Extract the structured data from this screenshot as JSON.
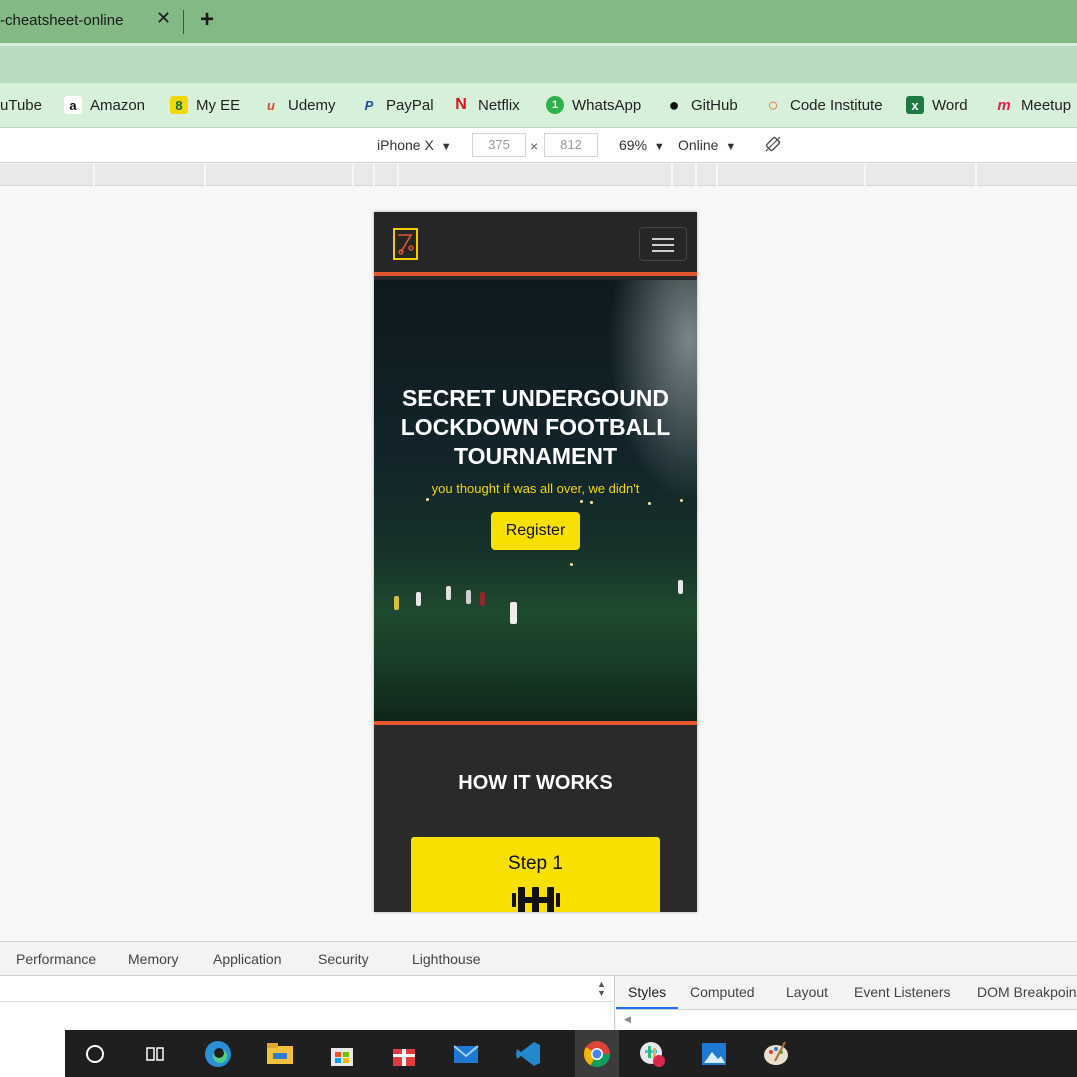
{
  "browser": {
    "tab_title": "-cheatsheet-online",
    "tab_close": "✕",
    "new_tab": "+"
  },
  "bookmarks": [
    {
      "label": "uTube",
      "icon": "youtube-icon"
    },
    {
      "label": "Amazon",
      "icon": "amazon-icon",
      "glyph": "a"
    },
    {
      "label": "My EE",
      "icon": "ee-icon",
      "glyph": "8"
    },
    {
      "label": "Udemy",
      "icon": "udemy-icon",
      "glyph": "u"
    },
    {
      "label": "PayPal",
      "icon": "paypal-icon",
      "glyph": "P"
    },
    {
      "label": "Netflix",
      "icon": "netflix-icon",
      "glyph": "N"
    },
    {
      "label": "WhatsApp",
      "icon": "whatsapp-icon",
      "glyph": "1"
    },
    {
      "label": "GitHub",
      "icon": "github-icon",
      "glyph": "●"
    },
    {
      "label": "Code Institute",
      "icon": "code-institute-icon",
      "glyph": "○"
    },
    {
      "label": "Word",
      "icon": "excel-icon",
      "glyph": "x"
    },
    {
      "label": "Meetup",
      "icon": "meetup-icon",
      "glyph": "m"
    }
  ],
  "device_toolbar": {
    "device": "iPhone X",
    "width": "375",
    "times": "×",
    "height": "812",
    "zoom": "69%",
    "network": "Online",
    "dropdown_arrow": "▼"
  },
  "site": {
    "hero_title": "SECRET UNDERGOUND LOCKDOWN FOOTBALL TOURNAMENT",
    "hero_subtitle": "you thought if was all over, we didn't",
    "register_label": "Register",
    "how_title": "HOW IT WORKS",
    "step_title": "Step 1"
  },
  "devtools": {
    "tabs": [
      "Performance",
      "Memory",
      "Application",
      "Security",
      "Lighthouse"
    ],
    "side_tabs": [
      "Styles",
      "Computed",
      "Layout",
      "Event Listeners",
      "DOM Breakpoin"
    ]
  },
  "colors": {
    "accent_orange": "#e4572e",
    "brand_yellow": "#f8e000",
    "tabbar_green": "#82b985"
  }
}
